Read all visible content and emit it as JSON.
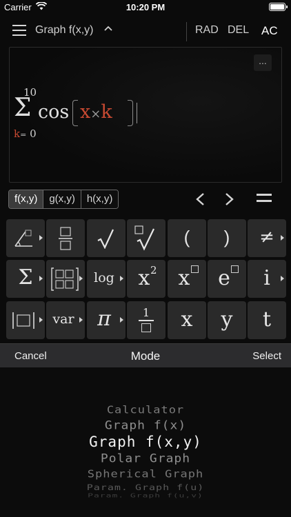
{
  "status_bar": {
    "carrier": "Carrier",
    "time": "10:20 PM"
  },
  "toolbar": {
    "mode_title": "Graph f(x,y)",
    "rad_label": "RAD",
    "del_label": "DEL",
    "ac_label": "AC"
  },
  "display": {
    "more_label": "...",
    "sum_upper": "10",
    "sum_symbol": "Σ",
    "sum_var": "k",
    "sum_eq": "=",
    "sum_lower_value": "0",
    "func": "cos",
    "arg_left": "x",
    "arg_op": "×",
    "arg_right": "k"
  },
  "function_tabs": [
    {
      "label": "f(x,y)"
    },
    {
      "label": "g(x,y)"
    },
    {
      "label": "h(x,y)"
    }
  ],
  "keypad": {
    "row1": {
      "paren_open": "(",
      "paren_close": ")",
      "not_equal": "≠"
    },
    "row2": {
      "sigma": "Σ",
      "log": "log",
      "x": "x",
      "squared": "2",
      "e": "e",
      "i": "i"
    },
    "row3": {
      "var": "var",
      "pi": "π",
      "frac_num": "1",
      "x": "x",
      "y": "y",
      "t": "t"
    }
  },
  "picker_sheet": {
    "cancel_label": "Cancel",
    "title": "Mode",
    "select_label": "Select",
    "options": [
      "Calculator",
      "Graph f(x)",
      "Graph f(x,y)",
      "Polar Graph",
      "Spherical Graph",
      "Param. Graph f(u)",
      "Param. Graph f(u,v)"
    ],
    "selected": "Graph f(x,y)"
  },
  "colors": {
    "accent_variable": "#c94a32",
    "key_bg": "#2a2a2a",
    "sheet_bar": "#2c2c2e"
  },
  "icons": [
    "wifi-icon",
    "battery-icon",
    "menu-icon",
    "chevron-up-icon",
    "chevron-left-icon",
    "chevron-right-icon",
    "equals-icon",
    "angle-icon",
    "fraction-icon",
    "sqrt-icon",
    "nth-root-icon",
    "matrix-icon",
    "power-icon",
    "abs-icon"
  ]
}
